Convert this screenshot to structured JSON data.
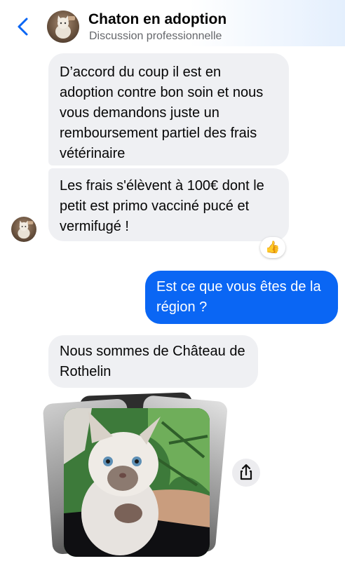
{
  "header": {
    "title": "Chaton en adoption",
    "subtitle": "Discussion professionnelle",
    "back_icon": "chevron-left-icon",
    "accent_color": "#0a66f4"
  },
  "messages": [
    {
      "direction": "incoming",
      "text": "D’accord du coup il est en adoption contre bon soin et nous vous demandons juste un remboursement partiel des frais vétérinaire"
    },
    {
      "direction": "incoming",
      "text": "Les frais s'élèvent à 100€ dont le petit est primo vacciné pucé et vermifugé !",
      "reaction": "👍"
    },
    {
      "direction": "outgoing",
      "text": "Est ce que vous êtes de la région ?"
    },
    {
      "direction": "incoming",
      "text": "Nous sommes de Château de Rothelin"
    }
  ],
  "photo": {
    "subject": "kitten-photo",
    "share_icon": "share-icon"
  },
  "colors": {
    "incoming_bubble": "#eff0f3",
    "outgoing_bubble": "#0a66f4",
    "subtitle": "#65676b"
  }
}
